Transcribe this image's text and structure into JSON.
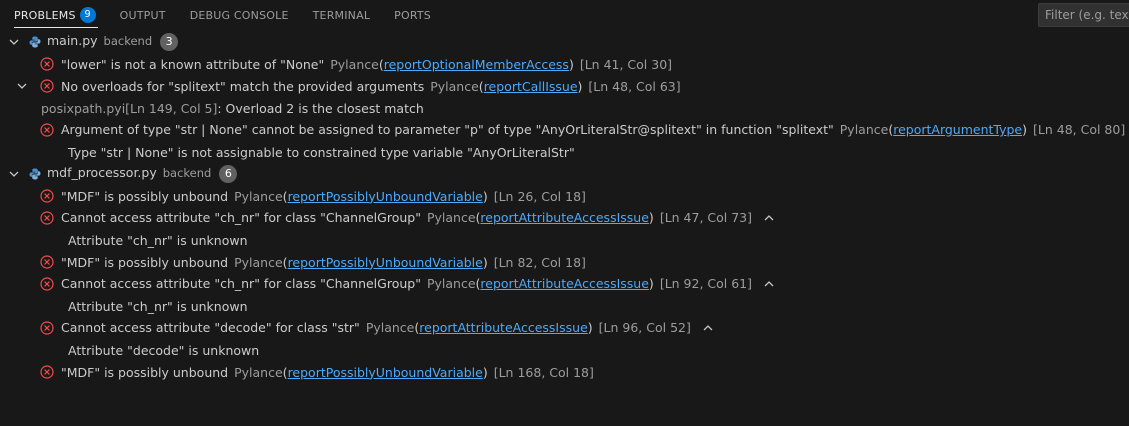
{
  "tabs": [
    {
      "label": "PROBLEMS",
      "badge": "9"
    },
    {
      "label": "OUTPUT"
    },
    {
      "label": "DEBUG CONSOLE"
    },
    {
      "label": "TERMINAL"
    },
    {
      "label": "PORTS"
    }
  ],
  "filter": {
    "placeholder": "Filter (e.g. text, **"
  },
  "files": [
    {
      "name": "main.py",
      "dir": "backend",
      "count": "3",
      "problems": [
        {
          "message": "\"lower\" is not a known attribute of \"None\"",
          "source": "Pylance",
          "code": "reportOptionalMemberAccess",
          "location": "[Ln 41, Col 30]"
        },
        {
          "message": "No overloads for \"splitext\" match the provided arguments",
          "source": "Pylance",
          "code": "reportCallIssue",
          "location": "[Ln 48, Col 63]",
          "related": {
            "path": "posixpath.pyi[Ln 149, Col 5]",
            "text": ": Overload 2 is the closest match"
          }
        },
        {
          "message": "Argument of type \"str | None\" cannot be assigned to parameter \"p\" of type \"AnyOrLiteralStr@splitext\" in function \"splitext\"",
          "source": "Pylance",
          "code": "reportArgumentType",
          "location": "[Ln 48, Col 80]",
          "detail": "Type \"str | None\" is not assignable to constrained type variable \"AnyOrLiteralStr\""
        }
      ]
    },
    {
      "name": "mdf_processor.py",
      "dir": "backend",
      "count": "6",
      "problems": [
        {
          "message": "\"MDF\" is possibly unbound",
          "source": "Pylance",
          "code": "reportPossiblyUnboundVariable",
          "location": "[Ln 26, Col 18]"
        },
        {
          "message": "Cannot access attribute \"ch_nr\" for class \"ChannelGroup\"",
          "source": "Pylance",
          "code": "reportAttributeAccessIssue",
          "location": "[Ln 47, Col 73]",
          "detail": "Attribute \"ch_nr\" is unknown"
        },
        {
          "message": "\"MDF\" is possibly unbound",
          "source": "Pylance",
          "code": "reportPossiblyUnboundVariable",
          "location": "[Ln 82, Col 18]"
        },
        {
          "message": "Cannot access attribute \"ch_nr\" for class \"ChannelGroup\"",
          "source": "Pylance",
          "code": "reportAttributeAccessIssue",
          "location": "[Ln 92, Col 61]",
          "detail": "Attribute \"ch_nr\" is unknown"
        },
        {
          "message": "Cannot access attribute \"decode\" for class \"str\"",
          "source": "Pylance",
          "code": "reportAttributeAccessIssue",
          "location": "[Ln 96, Col 52]",
          "detail": "Attribute \"decode\" is unknown"
        },
        {
          "message": "\"MDF\" is possibly unbound",
          "source": "Pylance",
          "code": "reportPossiblyUnboundVariable",
          "location": "[Ln 168, Col 18]"
        }
      ]
    }
  ],
  "colors": {
    "error": "#f14c4c",
    "link": "#4daafc",
    "badge": "#0078d4",
    "background": "#181818"
  }
}
